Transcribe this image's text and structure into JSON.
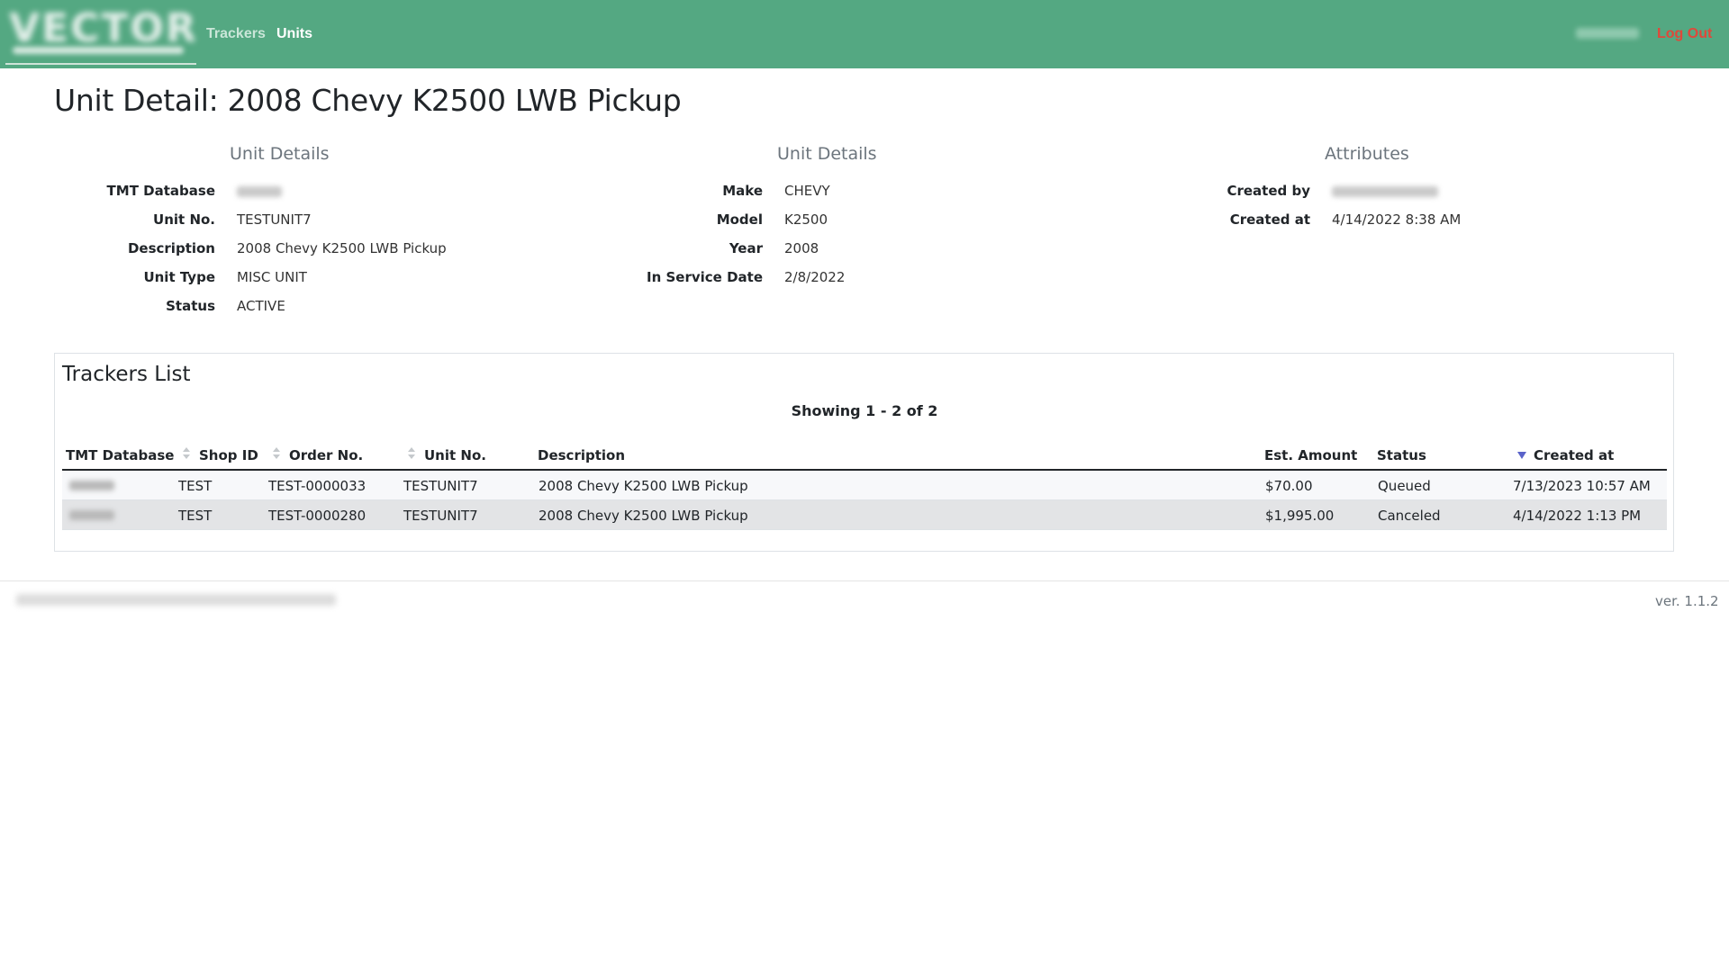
{
  "nav": {
    "links": [
      {
        "label": "Trackers"
      },
      {
        "label": "Units"
      }
    ],
    "logout_label": "Log Out"
  },
  "page": {
    "title": "Unit Detail: 2008 Chevy K2500 LWB Pickup"
  },
  "unit_details_left": {
    "heading": "Unit Details",
    "fields": [
      {
        "label": "TMT Database",
        "value": ""
      },
      {
        "label": "Unit No.",
        "value": "TESTUNIT7"
      },
      {
        "label": "Description",
        "value": "2008 Chevy K2500 LWB Pickup"
      },
      {
        "label": "Unit Type",
        "value": "MISC UNIT"
      },
      {
        "label": "Status",
        "value": "ACTIVE"
      }
    ]
  },
  "unit_details_mid": {
    "heading": "Unit Details",
    "fields": [
      {
        "label": "Make",
        "value": "CHEVY"
      },
      {
        "label": "Model",
        "value": "K2500"
      },
      {
        "label": "Year",
        "value": "2008"
      },
      {
        "label": "In Service Date",
        "value": "2/8/2022"
      }
    ]
  },
  "attributes": {
    "heading": "Attributes",
    "fields": [
      {
        "label": "Created by",
        "value": ""
      },
      {
        "label": "Created at",
        "value": "4/14/2022 8:38 AM"
      }
    ]
  },
  "trackers": {
    "title": "Trackers List",
    "showing": "Showing 1 - 2 of 2",
    "columns": [
      "TMT Database",
      "Shop ID",
      "Order No.",
      "Unit No.",
      "Description",
      "Est. Amount",
      "Status",
      "Created at"
    ],
    "rows": [
      {
        "tmt_db": "",
        "shop_id": "TEST",
        "order_no": "TEST-0000033",
        "unit_no": "TESTUNIT7",
        "description": "2008 Chevy K2500 LWB Pickup",
        "est_amount": "$70.00",
        "status": "Queued",
        "created_at": "7/13/2023 10:57 AM"
      },
      {
        "tmt_db": "",
        "shop_id": "TEST",
        "order_no": "TEST-0000280",
        "unit_no": "TESTUNIT7",
        "description": "2008 Chevy K2500 LWB Pickup",
        "est_amount": "$1,995.00",
        "status": "Canceled",
        "created_at": "4/14/2022 1:13 PM"
      }
    ]
  },
  "footer": {
    "version": "ver. 1.1.2"
  },
  "colors": {
    "navbar": "#54a882",
    "logout": "#e0483a",
    "sort_active": "#5a63c9"
  }
}
